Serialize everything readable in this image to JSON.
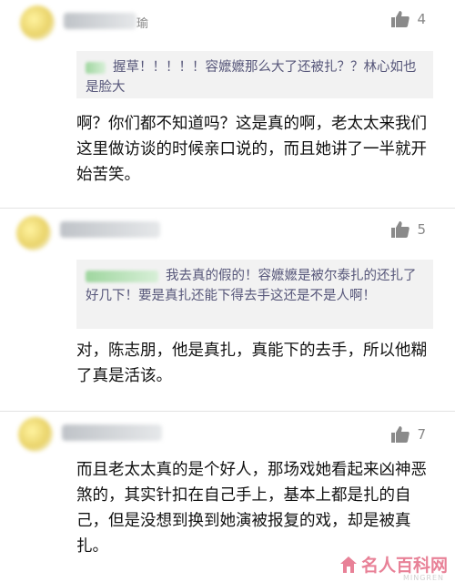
{
  "comments": [
    {
      "username_suffix": "瑜",
      "likes": "4",
      "quote": "握草！！！！！容嬷嬷那么大了还被扎？？林心如也是脸大",
      "text": "啊？你们都不知道吗？这是真的啊，老太太来我们这里做访谈的时候亲口说的，而且她讲了一半就开始苦笑。"
    },
    {
      "username_suffix": "",
      "likes": "5",
      "quote": "我去真的假的！容嬷嬷是被尔泰扎的还扎了好几下！要是真扎还能下得去手这还是不是人啊！",
      "text": "对，陈志朋，他是真扎，真能下的去手，所以他糊了真是活该。"
    },
    {
      "username_suffix": "",
      "likes": "7",
      "quote": "",
      "text": "而且老太太真的是个好人，那场戏她看起来凶神恶煞的，其实针扣在自己手上，基本上都是扎的自己，但是没想到换到她演被报复的戏，却是被真扎。"
    }
  ],
  "watermark": {
    "text": "名人百科网",
    "sub": "MINGREN"
  },
  "colors": {
    "quote_bg": "#f2f2f2",
    "quote_text": "#57577a",
    "like_gray": "#888888",
    "watermark_pink": "#e46c86"
  }
}
